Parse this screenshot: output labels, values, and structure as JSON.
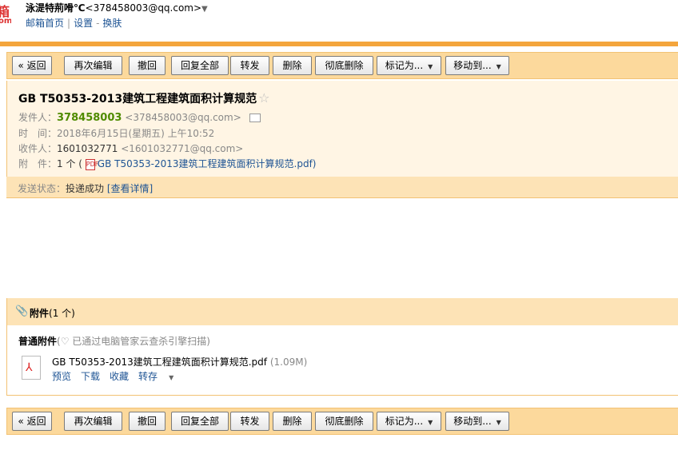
{
  "top": {
    "logo_line1": "箱",
    "logo_line2": "om",
    "nickname": "泳湜特荊嗗℃",
    "email": "<378458003@qq.com>",
    "account_caret": "▼",
    "links": [
      "邮箱首页",
      "设置",
      "换肤"
    ],
    "sep1": "|",
    "sep2": "-"
  },
  "toolbar": {
    "back": "« 返回",
    "reedit": "再次编辑",
    "recall": "撤回",
    "reply_all": "回复全部",
    "forward": "转发",
    "delete": "删除",
    "delete_forever": "彻底删除",
    "mark_as": "标记为...",
    "move_to": "移动到...",
    "caret": "▼"
  },
  "mail": {
    "subject": "GB T50353-2013建筑工程建筑面积计算规范",
    "star": "☆",
    "from_label": "发件人：",
    "from_name": "378458003",
    "from_email": "<378458003@qq.com>",
    "time_label": "时　间：",
    "time_value": "2018年6月15日(星期五) 上午10:52",
    "to_label": "收件人：",
    "to_name": "1601032771",
    "to_email": "<1601032771@qq.com>",
    "att_label": "附　件：",
    "att_count": "1 个 (",
    "att_icon": "PDF",
    "att_name": "GB T50353-2013建筑工程建筑面积计算规范.pdf",
    "att_close": ")"
  },
  "status": {
    "label": "发送状态：",
    "value": "投递成功",
    "detail": "[查看详情]"
  },
  "attachments": {
    "clip_icon": "📎",
    "title_bold": "附件",
    "title_count": "(1 个)",
    "kind": "普通附件",
    "scan_note": "(♡ 已通过电脑管家云查杀引擎扫描)",
    "file_name": "GB T50353-2013建筑工程建筑面积计算规范.pdf",
    "file_size": "(1.09M)",
    "pdf_symbol": "⅄",
    "actions": [
      "预览",
      "下载",
      "收藏",
      "转存"
    ],
    "action_caret": "▼"
  }
}
